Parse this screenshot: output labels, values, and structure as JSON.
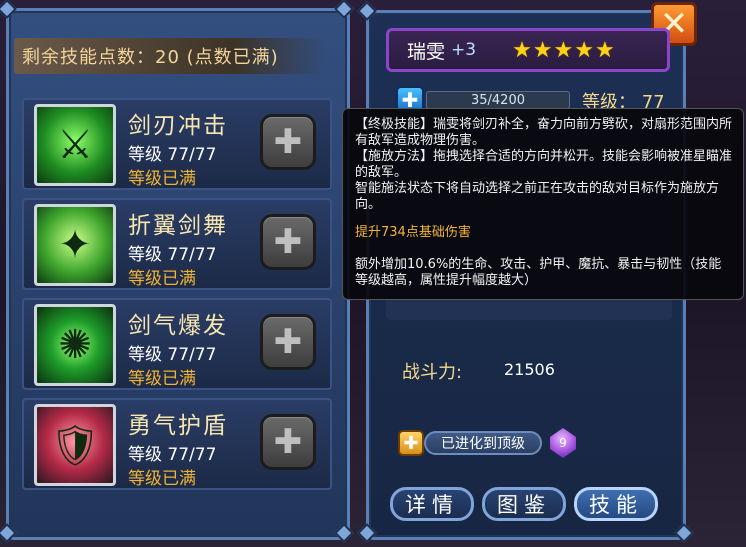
{
  "skill_points": {
    "text": "剩余技能点数：20 (点数已满)"
  },
  "skills": [
    {
      "name": "剑刃冲击",
      "level": "等级 77/77",
      "status": "等级已满",
      "icon": "sword-strike-icon"
    },
    {
      "name": "折翼剑舞",
      "level": "等级 77/77",
      "status": "等级已满",
      "icon": "wing-blade-dance-icon"
    },
    {
      "name": "剑气爆发",
      "level": "等级 77/77",
      "status": "等级已满",
      "icon": "sword-burst-icon"
    },
    {
      "name": "勇气护盾",
      "level": "等级 77/77",
      "status": "等级已满",
      "icon": "courage-shield-icon"
    }
  ],
  "hero": {
    "name": "瑞雯",
    "plus": "+3",
    "stars": "★★★★★",
    "star_count": 5,
    "exp": "35/4200",
    "level": "等级： 77",
    "power_label": "战斗力:",
    "power_value": "21506",
    "evolve_text": "已进化到顶级",
    "gem_value": "9"
  },
  "tabs": {
    "details": "详情",
    "codex": "图鉴",
    "skills": "技能",
    "active": "skills"
  },
  "tooltip": {
    "line1": "【终极技能】瑞雯将剑刃补全，奋力向前方劈砍，对扇形范围内所有敌军造成物理伤害。",
    "line2": "【施放方法】拖拽选择合适的方向并松开。技能会影响被准星瞄准的敌军。",
    "line3": "智能施法状态下将自动选择之前正在攻击的敌对目标作为施放方向。",
    "highlight": "提升734点基础伤害",
    "line4": "额外增加10.6%的生命、攻击、护甲、魔抗、暴击与韧性（技能等级越高，属性提升幅度越大）"
  },
  "colors": {
    "panel_border": "#5a7fb6",
    "skill_name": "#f7e6b0",
    "max_level": "#f0b332",
    "star": "#ffd21a",
    "tooltip_highlight": "#f3b43a"
  }
}
